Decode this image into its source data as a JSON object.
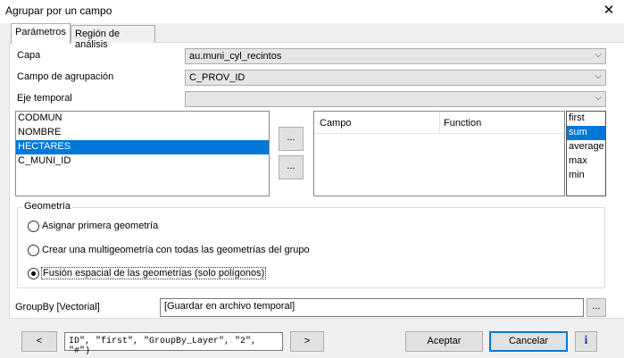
{
  "window": {
    "title": "Agrupar por un campo",
    "close_icon": "✕"
  },
  "tabs": [
    {
      "label": "Parámetros"
    },
    {
      "label": "Región de análisis"
    }
  ],
  "params": {
    "layer_label": "Capa",
    "layer_value": "au.muni_cyl_recintos",
    "group_field_label": "Campo de agrupación",
    "group_field_value": "C_PROV_ID",
    "time_axis_label": "Eje temporal",
    "time_axis_value": ""
  },
  "fields_list": [
    "CODMUN",
    "NOMBRE",
    "HECTARES",
    "C_MUNI_ID"
  ],
  "more_button": "...",
  "stats_table": {
    "col_field": "Campo",
    "col_function": "Function"
  },
  "functions_list": [
    "first",
    "sum",
    "average",
    "max",
    "min"
  ],
  "geometry": {
    "title": "Geometría",
    "options": [
      "Asignar primera geometría",
      "Crear una multigeometría con todas las geometrías del grupo",
      "Fusión espacial de las geometrías (solo polígonos)"
    ],
    "selected_index": 2
  },
  "output": {
    "label": "GroupBy [Vectorial]",
    "value": "[Guardar en archivo temporal]",
    "browse": "..."
  },
  "footer": {
    "prev": "<",
    "command": "ID\", \"first\", \"GroupBy_Layer\", \"2\", \"#\")",
    "next": ">",
    "accept": "Aceptar",
    "cancel": "Cancelar",
    "info": "i"
  }
}
